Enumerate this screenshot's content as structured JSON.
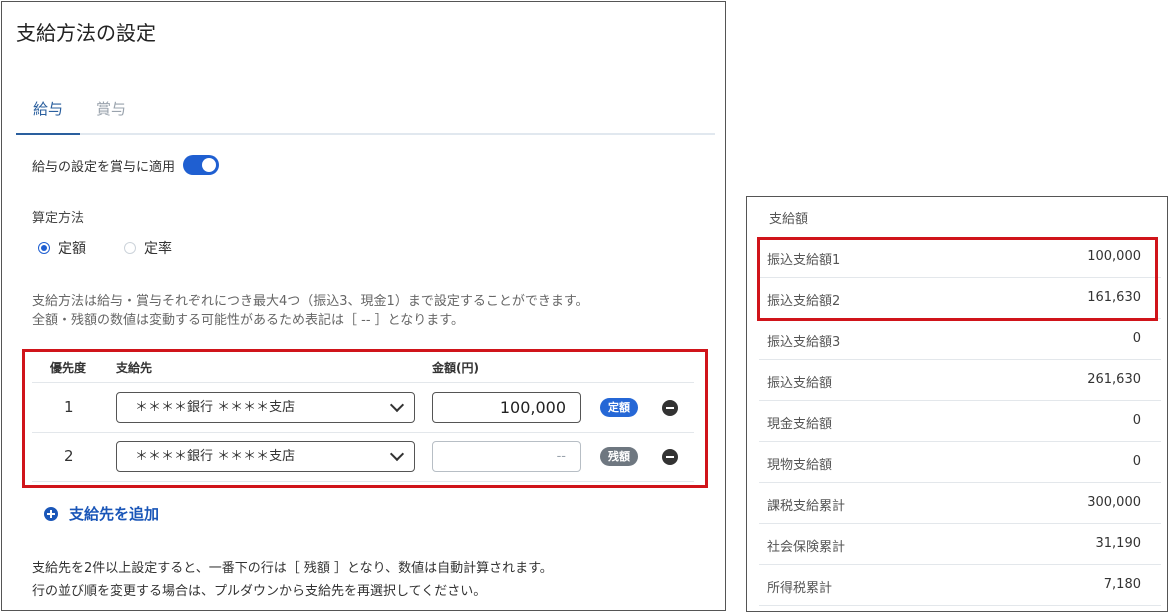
{
  "left": {
    "title": "支給方法の設定",
    "tabs": [
      "給与",
      "賞与"
    ],
    "apply_toggle_label": "給与の設定を賞与に適用",
    "calc_method_label": "算定方法",
    "calc_options": [
      "定額",
      "定率"
    ],
    "notes": [
      "支給方法は給与・賞与それぞれにつき最大4つ（振込3、現金1）まで設定することができます。",
      "全額・残額の数値は変動する可能性があるため表記は［ -- ］となります。"
    ],
    "table": {
      "headers": [
        "優先度",
        "支給先",
        "金額(円)"
      ],
      "rows": [
        {
          "priority": "1",
          "destination": "＊＊＊＊銀行 ＊＊＊＊支店",
          "amount": "100,000",
          "badge": "定額"
        },
        {
          "priority": "2",
          "destination": "＊＊＊＊銀行 ＊＊＊＊支店",
          "amount": "--",
          "badge": "残額"
        }
      ]
    },
    "add_label": "支給先を追加",
    "footer": [
      "支給先を2件以上設定すると、一番下の行は［ 残額 ］となり、数値は自動計算されます。",
      "行の並び順を変更する場合は、プルダウンから支給先を再選択してください。"
    ]
  },
  "right": {
    "header": "支給額",
    "rows": [
      {
        "label": "振込支給額1",
        "value": "100,000"
      },
      {
        "label": "振込支給額2",
        "value": "161,630"
      },
      {
        "label": "振込支給額3",
        "value": "0"
      },
      {
        "label": "振込支給額",
        "value": "261,630"
      },
      {
        "label": "現金支給額",
        "value": "0"
      },
      {
        "label": "現物支給額",
        "value": "0"
      },
      {
        "label": "課税支給累計",
        "value": "300,000"
      },
      {
        "label": "社会保険累計",
        "value": "31,190"
      },
      {
        "label": "所得税累計",
        "value": "7,180"
      }
    ]
  },
  "colors": {
    "accent": "#1f5fd1",
    "highlight": "#d0141a",
    "badge_fixed": "#2567d6",
    "badge_rest": "#6e7780"
  }
}
